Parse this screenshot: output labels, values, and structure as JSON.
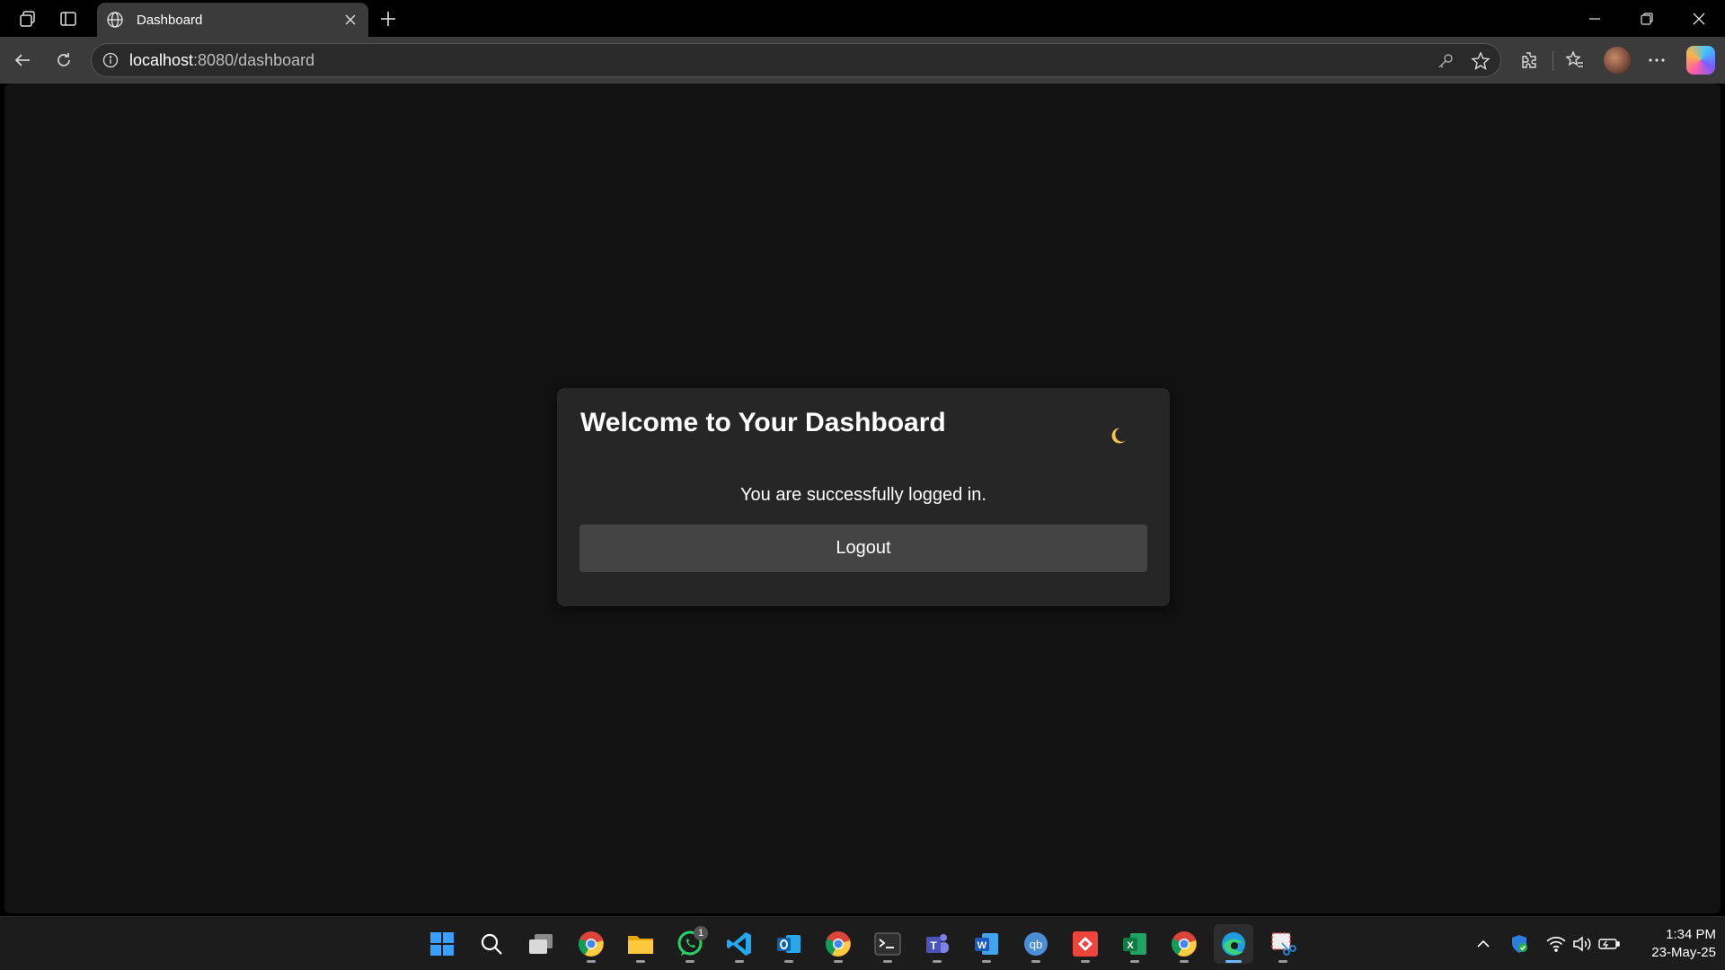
{
  "browser": {
    "tab": {
      "title": "Dashboard"
    },
    "address": {
      "host": "localhost",
      "path": ":8080/dashboard"
    }
  },
  "page": {
    "card": {
      "title": "Welcome to Your Dashboard",
      "message": "You are successfully logged in.",
      "logout_label": "Logout",
      "theme_icon": "moon-icon"
    },
    "colors": {
      "page_background": "#121212",
      "card_background": "#262626",
      "button_background": "#444444"
    }
  },
  "taskbar": {
    "apps": [
      {
        "name": "start-icon"
      },
      {
        "name": "search-icon"
      },
      {
        "name": "task-view-icon"
      },
      {
        "name": "chrome-icon"
      },
      {
        "name": "file-explorer-icon"
      },
      {
        "name": "whatsapp-icon",
        "badge": "1"
      },
      {
        "name": "vscode-icon"
      },
      {
        "name": "outlook-icon"
      },
      {
        "name": "chrome-icon"
      },
      {
        "name": "terminal-icon"
      },
      {
        "name": "teams-icon"
      },
      {
        "name": "word-icon"
      },
      {
        "name": "qbittorrent-icon"
      },
      {
        "name": "anydesk-icon"
      },
      {
        "name": "excel-icon"
      },
      {
        "name": "chrome-icon"
      },
      {
        "name": "edge-icon",
        "active": true
      },
      {
        "name": "snipping-tool-icon"
      }
    ],
    "clock": {
      "time": "1:34 PM",
      "date": "23-May-25"
    }
  }
}
